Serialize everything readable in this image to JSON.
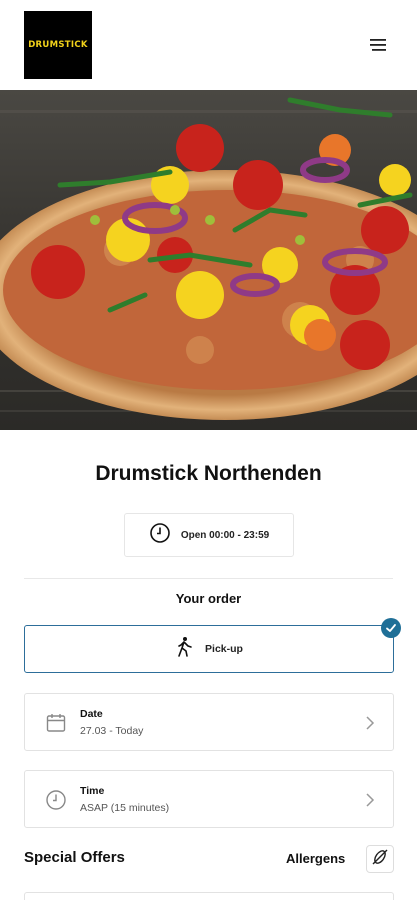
{
  "header": {
    "logo_text": "DRUMSTICK",
    "menu_icon": "hamburger-menu-icon"
  },
  "hero": {
    "image_subject": "vegetable pizza with tomatoes, peppers, red onion and rocket"
  },
  "restaurant": {
    "name": "Drumstick Northenden",
    "hours": "Open 00:00 - 23:59"
  },
  "order": {
    "heading": "Your order",
    "mode_label": "Pick-up",
    "date": {
      "label": "Date",
      "value": "27.03 - Today"
    },
    "time": {
      "label": "Time",
      "value": "ASAP (15 minutes)"
    }
  },
  "sections": {
    "offers": "Special Offers",
    "allergens": "Allergens"
  },
  "colors": {
    "accent": "#1f6f97",
    "logo_text": "#f2d21a",
    "border": "#e2e2e2"
  }
}
